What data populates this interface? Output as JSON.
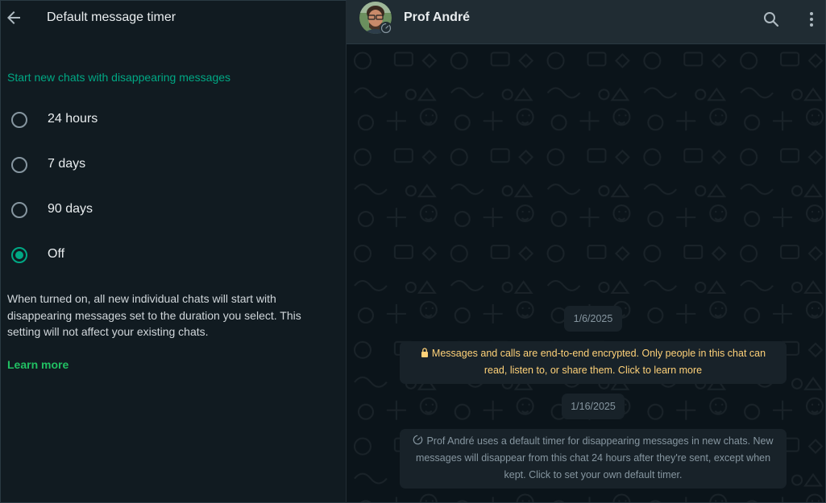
{
  "left": {
    "title": "Default message timer",
    "section_label": "Start new chats with disappearing messages",
    "options": [
      {
        "label": "24 hours",
        "selected": false
      },
      {
        "label": "7 days",
        "selected": false
      },
      {
        "label": "90 days",
        "selected": false
      },
      {
        "label": "Off",
        "selected": true
      }
    ],
    "description": "When turned on, all new individual chats will start with disappearing messages set to the duration you select. This setting will not affect your existing chats.",
    "learn_more": "Learn more"
  },
  "chat": {
    "contact_name": "Prof André",
    "date_1": "1/6/2025",
    "encryption_notice": "Messages and calls are end-to-end encrypted. Only people in this chat can read, listen to, or share them. Click to learn more",
    "date_2": "1/16/2025",
    "timer_notice": "Prof André uses a default timer for disappearing messages in new chats. New messages will disappear from this chat 24 hours after they're sent, except when kept. Click to set your own default timer."
  },
  "icons": {
    "back": "arrow-left-icon",
    "search": "search-icon",
    "menu": "kebab-menu-icon",
    "lock": "lock-icon",
    "timer": "timer-icon"
  },
  "colors": {
    "accent": "#00a884",
    "link": "#21c063",
    "encrypt_text": "#ffd279",
    "panel_bg": "#111b21",
    "header_bg": "#202c33",
    "chat_bg": "#0b141a"
  }
}
